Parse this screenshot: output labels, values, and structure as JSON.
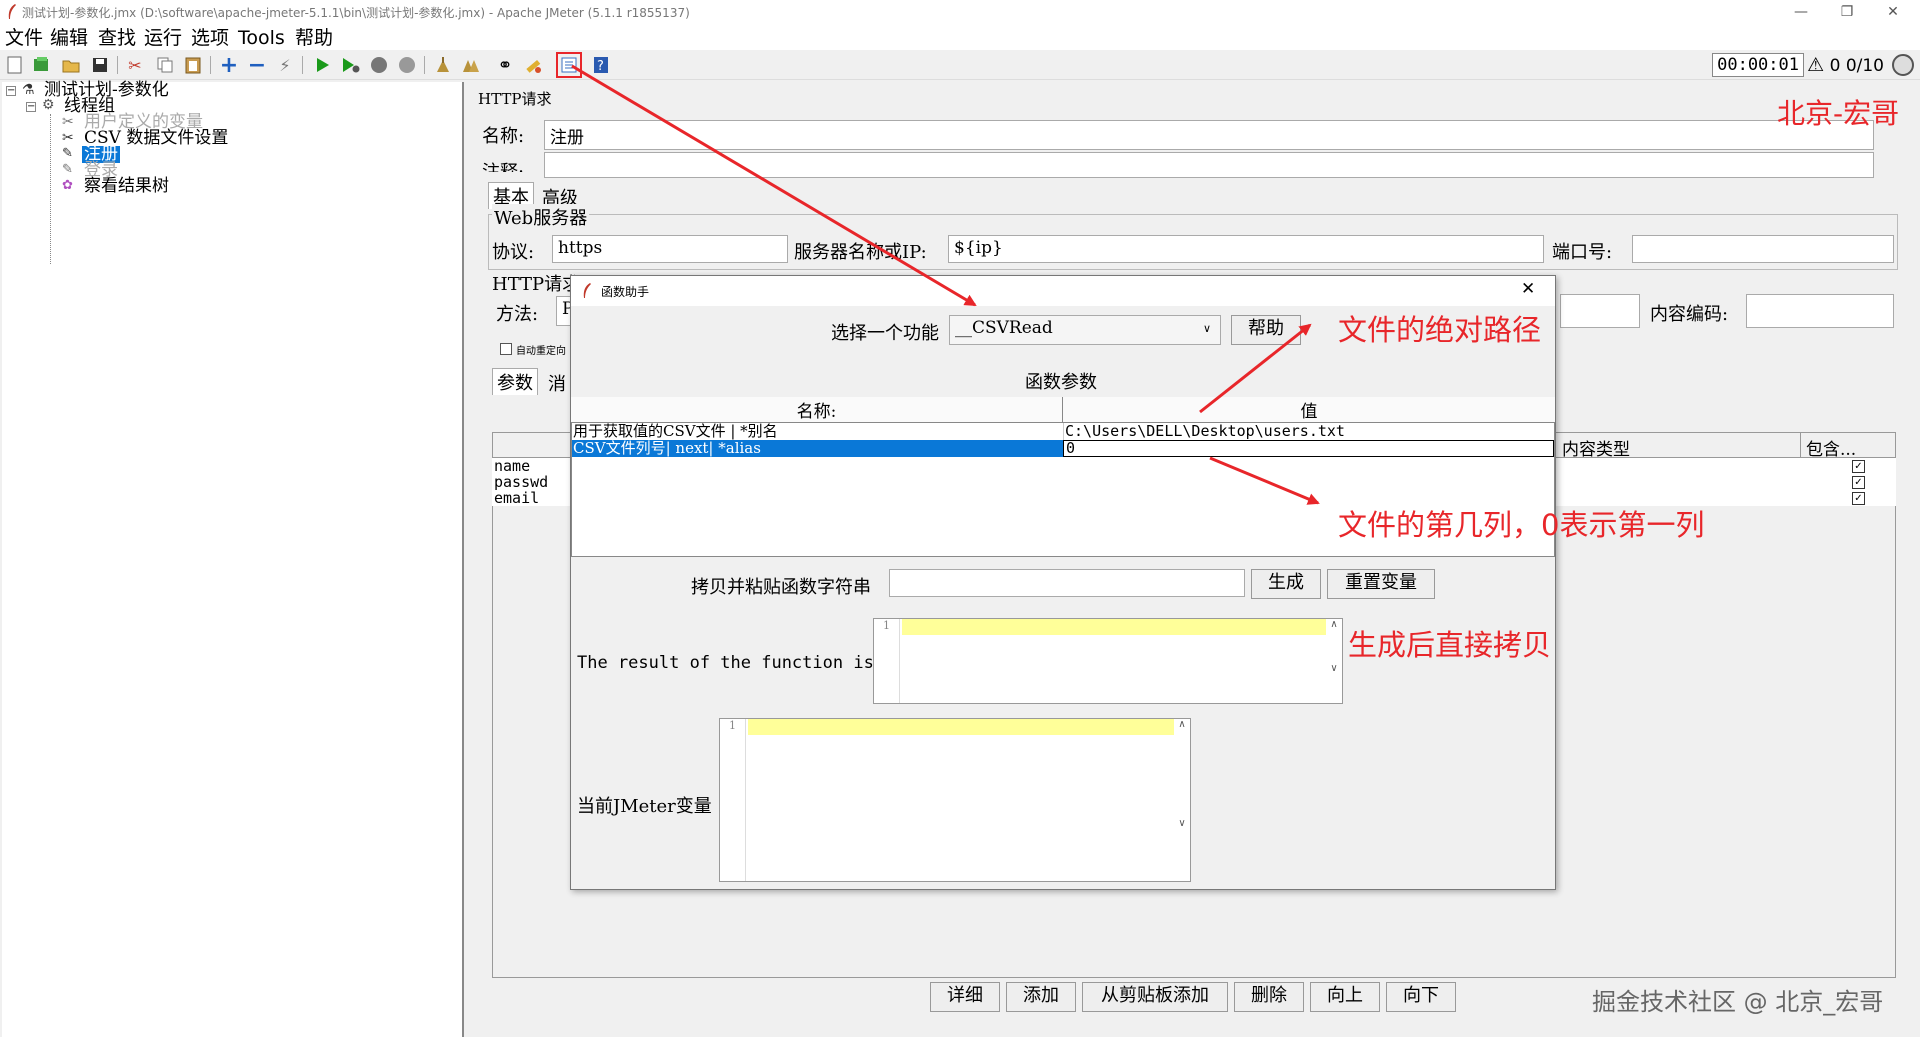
{
  "window": {
    "title": "测试计划-参数化.jmx (D:\\software\\apache-jmeter-5.1.1\\bin\\测试计划-参数化.jmx) - Apache JMeter (5.1.1 r1855137)",
    "minimize": "—",
    "restore": "❐",
    "close": "✕"
  },
  "menu": [
    "文件",
    "编辑",
    "查找",
    "运行",
    "选项",
    "Tools",
    "帮助"
  ],
  "toolbar": {
    "timer": "00:00:01",
    "warn_count": "0",
    "threads": "0/10"
  },
  "tree": {
    "plan": "测试计划-参数化",
    "thread_group": "线程组",
    "user_vars": "用户定义的变量",
    "csv": "CSV 数据文件设置",
    "register": "注册",
    "login": "登录",
    "result_tree": "察看结果树"
  },
  "http": {
    "panel_title": "HTTP请求",
    "name_label": "名称:",
    "name_value": "注册",
    "comment_label": "注释:",
    "tab_basic": "基本",
    "tab_advanced": "高级",
    "web_server": "Web服务器",
    "protocol_label": "协议:",
    "protocol_value": "https",
    "server_label": "服务器名称或IP:",
    "server_value": "${ip}",
    "port_label": "端口号:",
    "request_section": "HTTP请求",
    "method_label": "方法:",
    "method_value": "P",
    "encoding_label": "内容编码:",
    "auto_redirect": "自动重定向",
    "tab_params": "参数",
    "tab_body": "消",
    "col_content_type": "内容类型",
    "col_include": "包含...",
    "params": [
      "name",
      "passwd",
      "email"
    ],
    "buttons": [
      "详细",
      "添加",
      "从剪贴板添加",
      "删除",
      "向上",
      "向下"
    ]
  },
  "dialog": {
    "title": "函数助手",
    "close": "✕",
    "choose_label": "选择一个功能",
    "function_value": "__CSVRead",
    "help_button": "帮助",
    "params_title": "函数参数",
    "col_name": "名称:",
    "col_value": "值",
    "rows": [
      {
        "name": "用于获取值的CSV文件 | *别名",
        "value": "C:\\Users\\DELL\\Desktop\\users.txt"
      },
      {
        "name": "CSV文件列号| next| *alias",
        "value": "0"
      }
    ],
    "copy_label": "拷贝并粘贴函数字符串",
    "generate_button": "生成",
    "reset_button": "重置变量",
    "result_label": "The result of the function is",
    "vars_label": "当前JMeter变量",
    "line_number": "1"
  },
  "annotations": {
    "author": "北京-宏哥",
    "abs_path": "文件的绝对路径",
    "column": "文件的第几列，0表示第一列",
    "copy": "生成后直接拷贝",
    "watermark": "掘金技术社区 @ 北京_宏哥"
  },
  "colors": {
    "annotation": "#e8262a",
    "selection": "#0a78d7",
    "highlight_line": "#ffff99"
  }
}
